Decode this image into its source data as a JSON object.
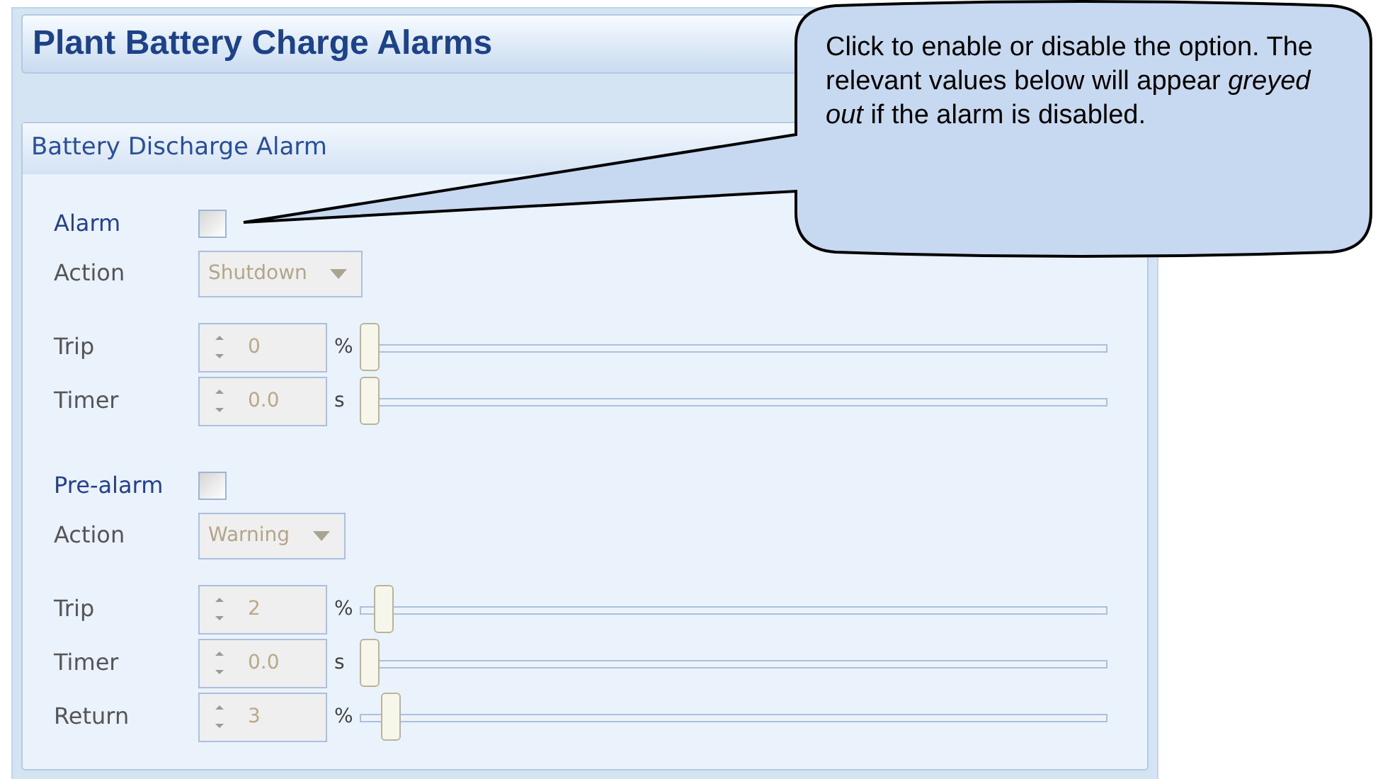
{
  "title": "Plant Battery Charge Alarms",
  "group": {
    "title": "Battery Discharge Alarm",
    "alarms": [
      {
        "label": "Alarm",
        "checked": false,
        "action_label": "Action",
        "action": "Shutdown",
        "settings": [
          {
            "label": "Trip",
            "value": "0",
            "unit": "%",
            "level": 0
          },
          {
            "label": "Timer",
            "value": "0.0",
            "unit": "s",
            "level": 0
          }
        ]
      },
      {
        "label": "Pre-alarm",
        "checked": false,
        "action_label": "Action",
        "action": "Warning",
        "settings": [
          {
            "label": "Trip",
            "value": "2",
            "unit": "%",
            "level": 0.02
          },
          {
            "label": "Timer",
            "value": "0.0",
            "unit": "s",
            "level": 0
          },
          {
            "label": "Return",
            "value": "3",
            "unit": "%",
            "level": 0.03
          }
        ]
      }
    ]
  },
  "callout": {
    "text": "Click to enable or disable the option. The relevant values below will appear *greyed out* if the alarm is disabled."
  }
}
